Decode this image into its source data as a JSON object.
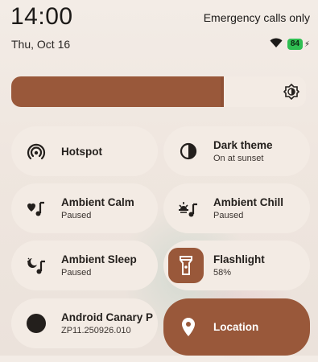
{
  "status": {
    "time": "14:00",
    "network_text": "Emergency calls only",
    "date": "Thu, Oct 16",
    "battery": "84"
  },
  "brightness": {
    "level": 0.715
  },
  "tiles": [
    {
      "name": "Hotspot",
      "subtitle": "",
      "icon": "hotspot-icon",
      "active": false
    },
    {
      "name": "Dark theme",
      "subtitle": "On at sunset",
      "icon": "dark-theme-icon",
      "active": false
    },
    {
      "name": "Ambient Calm",
      "subtitle": "Paused",
      "icon": "heart-music-icon",
      "active": false
    },
    {
      "name": "Ambient Chill",
      "subtitle": "Paused",
      "icon": "sunset-music-icon",
      "active": false
    },
    {
      "name": "Ambient Sleep",
      "subtitle": "Paused",
      "icon": "moon-music-icon",
      "active": false
    },
    {
      "name": "Flashlight",
      "subtitle": "58%",
      "icon": "flashlight-icon",
      "active": true
    },
    {
      "name": "Android Canary P",
      "subtitle": "ZP11.250926.010",
      "icon": "android-canary-icon",
      "active": false
    },
    {
      "name": "Location",
      "subtitle": "",
      "icon": "location-icon",
      "active": true
    }
  ],
  "colors": {
    "accent": "#99583a",
    "tile_bg": "#f3ebe4",
    "battery": "#2fbe52"
  }
}
